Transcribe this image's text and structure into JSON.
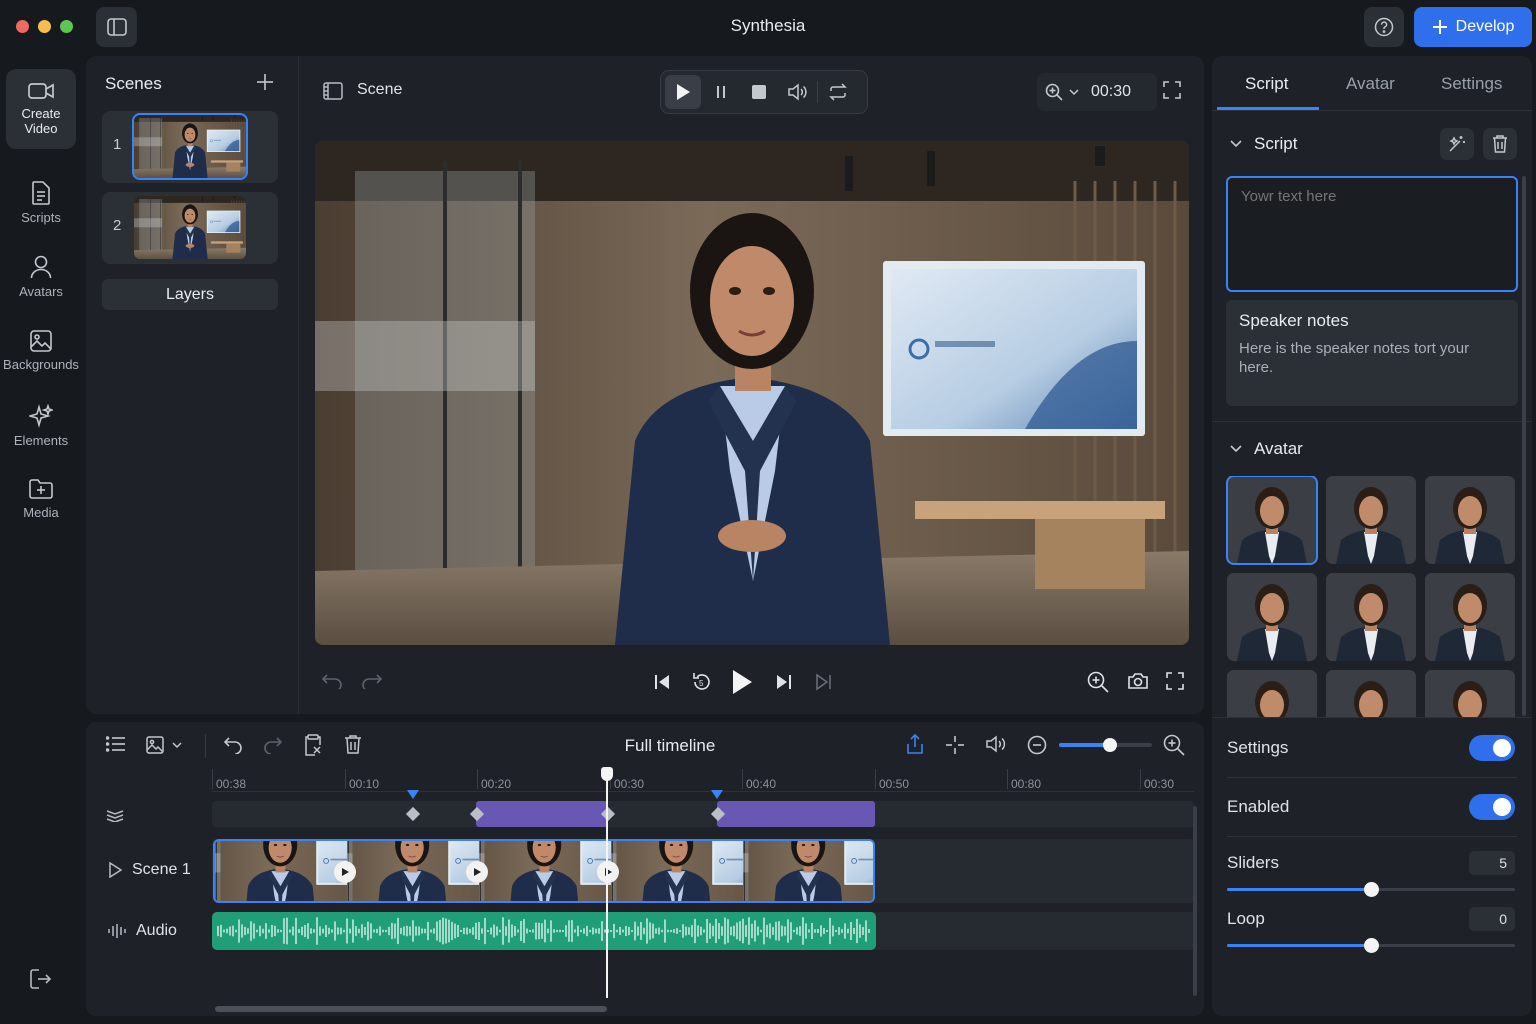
{
  "window": {
    "title": "Synthesia",
    "develop_label": "Develop"
  },
  "left_rail": {
    "items": [
      {
        "label": "Create Video",
        "icon": "video-camera-icon"
      },
      {
        "label": "Scripts",
        "icon": "document-icon"
      },
      {
        "label": "Avatars",
        "icon": "person-icon"
      },
      {
        "label": "Backgrounds",
        "icon": "image-icon"
      },
      {
        "label": "Elements",
        "icon": "sparkle-icon"
      },
      {
        "label": "Media",
        "icon": "folder-plus-icon"
      }
    ]
  },
  "scenes": {
    "title": "Scenes",
    "items": [
      {
        "number": "1"
      },
      {
        "number": "2"
      }
    ],
    "layers_label": "Layers"
  },
  "canvas": {
    "scene_label": "Scene",
    "time": "00:30"
  },
  "timeline": {
    "title": "Full timeline",
    "ticks": [
      "00:38",
      "00:10",
      "00:20",
      "00:30",
      "00:40",
      "00:50",
      "00:80",
      "00:30"
    ],
    "tracks": [
      {
        "label": "Scene 1"
      },
      {
        "label": "Audio"
      }
    ],
    "zoom_level": 0.55
  },
  "right_panel": {
    "tabs": [
      "Script",
      "Avatar",
      "Settings"
    ],
    "active_tab": "Script",
    "script_header": "Script",
    "script_placeholder": "Yowr text here",
    "notes_title": "Speaker notes",
    "notes_text": "Here is the speaker notes tort your here.",
    "avatar_header": "Avatar",
    "settings_label": "Settings",
    "settings_on": true,
    "enabled_label": "Enabled",
    "enabled_on": true,
    "sliders_label": "Sliders",
    "sliders_value": "5",
    "sliders_level": 0.5,
    "loop_label": "Loop",
    "loop_value": "0",
    "loop_level": 0.5
  },
  "colors": {
    "accent": "#3b82f6",
    "button": "#2f6fec",
    "audio": "#1f9e77",
    "keyframe": "#6957b4"
  }
}
